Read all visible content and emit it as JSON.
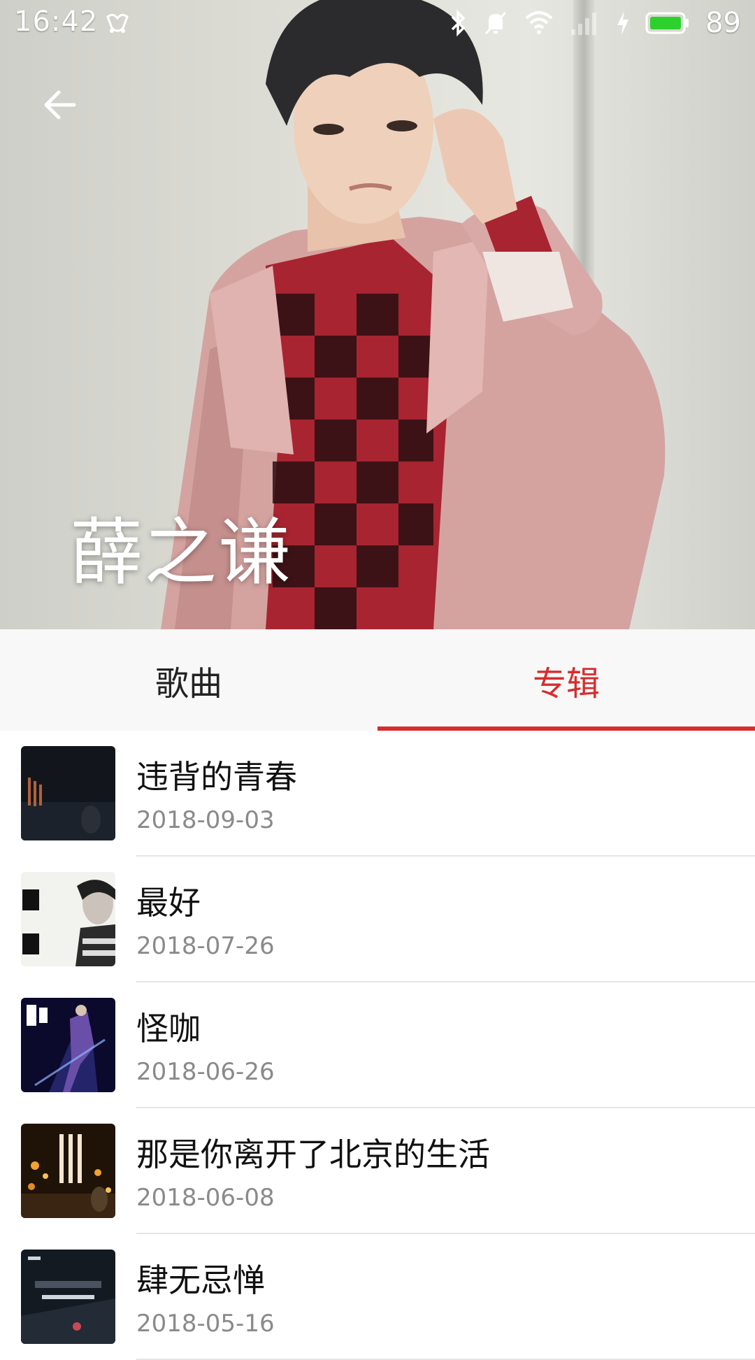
{
  "status_bar": {
    "time": "16:42",
    "battery_level": "89",
    "icons": [
      "notification-app-icon",
      "bluetooth-icon",
      "mute-icon",
      "wifi-icon",
      "signal-icon",
      "charging-icon",
      "battery-icon"
    ]
  },
  "header": {
    "artist_name": "薛之谦",
    "back_icon": "arrow-left-icon"
  },
  "tabs": [
    {
      "label": "歌曲",
      "active": false
    },
    {
      "label": "专辑",
      "active": true
    }
  ],
  "colors": {
    "accent": "#d62d2d",
    "title_text": "#111111",
    "date_text": "#8a8a8a"
  },
  "albums": [
    {
      "title": "违背的青春",
      "date": "2018-09-03"
    },
    {
      "title": "最好",
      "date": "2018-07-26"
    },
    {
      "title": "怪咖",
      "date": "2018-06-26"
    },
    {
      "title": "那是你离开了北京的生活",
      "date": "2018-06-08"
    },
    {
      "title": "肆无忌惮",
      "date": "2018-05-16"
    }
  ]
}
